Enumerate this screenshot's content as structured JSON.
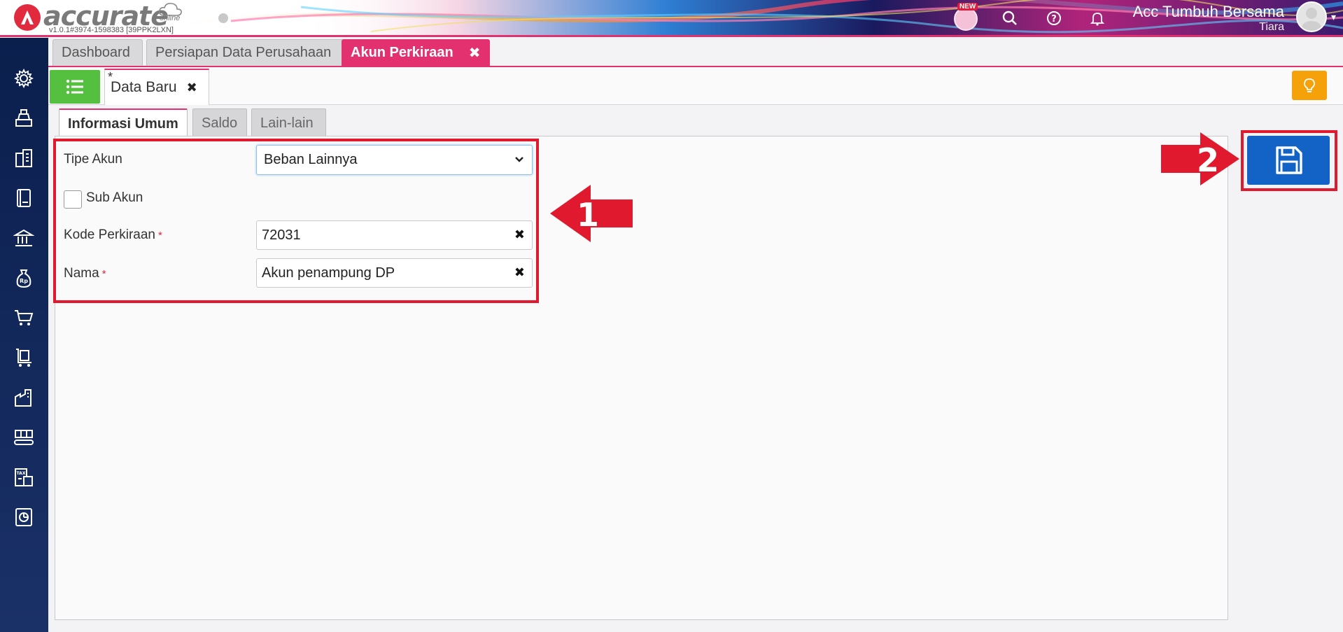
{
  "app": {
    "logo_text": "accurate",
    "logo_sub": "online",
    "version": "v1.0.1#3974-1598383 [39PPK2LXN]",
    "new_badge": "NEW",
    "company_name": "Acc Tumbuh Bersama",
    "user_name": "Tiara"
  },
  "main_tabs": [
    {
      "label": "Dashboard"
    },
    {
      "label": "Persiapan Data Perusahaan"
    },
    {
      "label": "Akun Perkiraan"
    }
  ],
  "tab_count": "3",
  "doc_tab": {
    "modified_marker": "*",
    "label": "Data Baru"
  },
  "form_tabs": [
    {
      "label": "Informasi Umum"
    },
    {
      "label": "Saldo"
    },
    {
      "label": "Lain-lain"
    }
  ],
  "form": {
    "tipe_akun_label": "Tipe Akun",
    "tipe_akun_value": "Beban Lainnya",
    "sub_akun_label": "Sub Akun",
    "kode_label": "Kode Perkiraan",
    "kode_value": "72031",
    "nama_label": "Nama",
    "nama_value": "Akun penampung DP",
    "required_marker": "*"
  },
  "annotations": {
    "step1": "1",
    "step2": "2"
  },
  "colors": {
    "accent_pink": "#e3306e",
    "sidebar_navy": "#0b1f4d",
    "list_green": "#55c03f",
    "save_blue": "#1363c6",
    "bulb_orange": "#f5a10a",
    "callout_red": "#e0192e"
  },
  "icons": {
    "sidebar": [
      "gear-icon",
      "cash-register-icon",
      "building-icon",
      "book-icon",
      "bank-icon",
      "money-bag-icon",
      "cart-icon",
      "trolley-icon",
      "factory-icon",
      "conveyor-icon",
      "tax-icon",
      "report-chart-icon"
    ],
    "header": [
      "search-icon",
      "help-icon",
      "bell-icon"
    ]
  }
}
